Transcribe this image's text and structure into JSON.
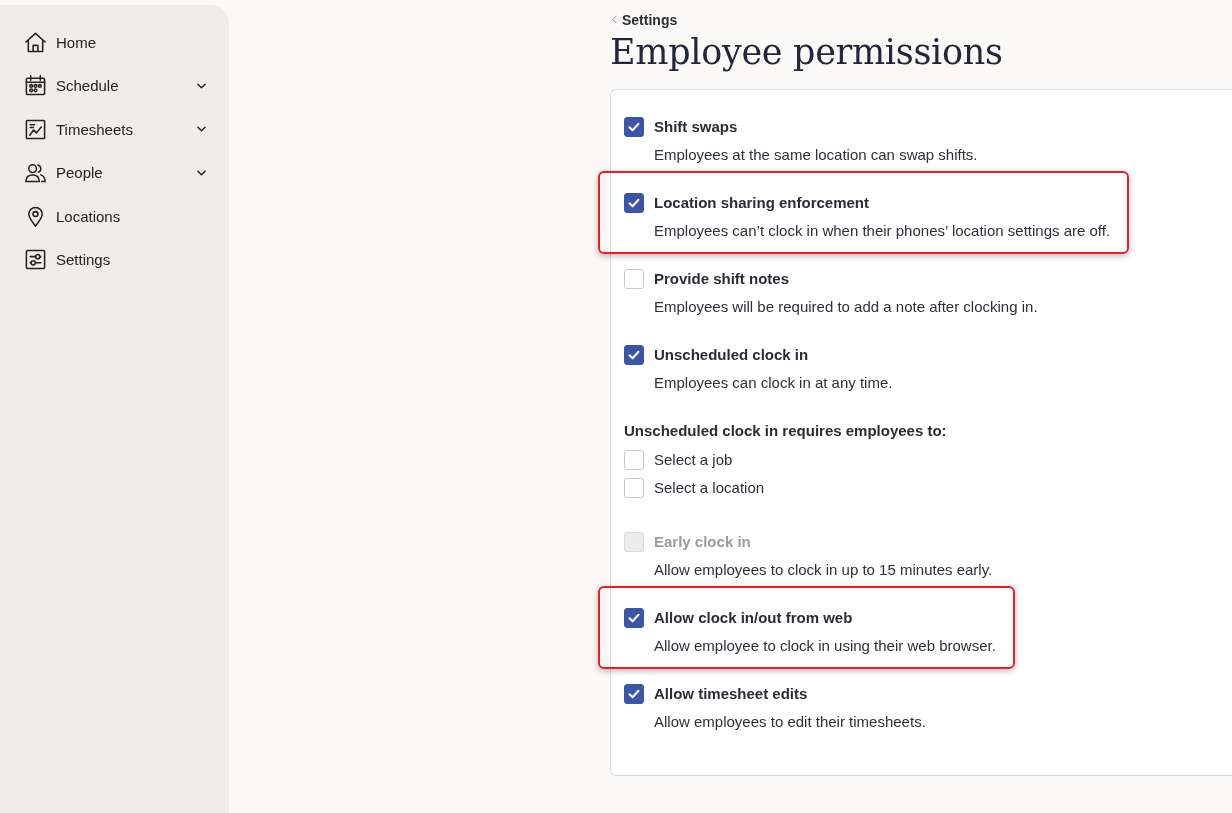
{
  "sidebar": {
    "items": [
      {
        "label": "Home",
        "kind": "link"
      },
      {
        "label": "Schedule",
        "kind": "group"
      },
      {
        "label": "Timesheets",
        "kind": "group"
      },
      {
        "label": "People",
        "kind": "group"
      },
      {
        "label": "Locations",
        "kind": "link"
      },
      {
        "label": "Settings",
        "kind": "link"
      }
    ]
  },
  "breadcrumb": {
    "label": "Settings"
  },
  "title": "Employee permissions",
  "permissions": [
    {
      "kind": "setting",
      "label": "Shift swaps",
      "description": "Employees at the same location can swap shifts.",
      "checked": true,
      "disabled": false,
      "highlighted": false
    },
    {
      "kind": "setting",
      "label": "Location sharing enforcement",
      "description": "Employees can’t clock in when their phones’ location settings are off.",
      "checked": true,
      "disabled": false,
      "highlighted": true
    },
    {
      "kind": "setting",
      "label": "Provide shift notes",
      "description": "Employees will be required to add a note after clocking in.",
      "checked": false,
      "disabled": false,
      "highlighted": false
    },
    {
      "kind": "setting",
      "label": "Unscheduled clock in",
      "description": "Employees can clock in at any time.",
      "checked": true,
      "disabled": false,
      "highlighted": false
    },
    {
      "kind": "requirements",
      "heading": "Unscheduled clock in requires employees to:",
      "options": [
        {
          "label": "Select a job",
          "checked": false
        },
        {
          "label": "Select a location",
          "checked": false
        }
      ]
    },
    {
      "kind": "setting",
      "label": "Early clock in",
      "description": "Allow employees to clock in up to 15 minutes early.",
      "checked": false,
      "disabled": true,
      "highlighted": false
    },
    {
      "kind": "setting",
      "label": "Allow clock in/out from web",
      "description": "Allow employee to clock in using their web browser.",
      "checked": true,
      "disabled": false,
      "highlighted": true
    },
    {
      "kind": "setting",
      "label": "Allow timesheet edits",
      "description": "Allow employees to edit their timesheets.",
      "checked": true,
      "disabled": false,
      "highlighted": false
    }
  ]
}
